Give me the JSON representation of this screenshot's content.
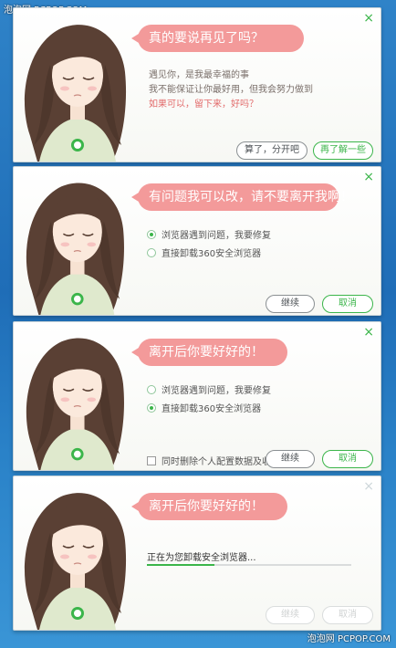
{
  "watermarks": {
    "top": "泡泡网 PCPOP.COM",
    "bottom": "泡泡网 PCPOP.COM"
  },
  "colors": {
    "accent_green": "#3bb54a",
    "bubble_pink": "#f39a9a",
    "desktop_blue": "#1f6db7"
  },
  "dialog1": {
    "bubble": "真的要说再见了吗？",
    "lines": [
      "遇见你，是我最幸福的事",
      "我不能保证让你最好用，但我会努力做到",
      "如果可以，留下来，好吗？"
    ],
    "btn_left": "算了，分开吧",
    "btn_right": "再了解一些",
    "close": "×"
  },
  "dialog2": {
    "bubble": "有问题我可以改，请不要离开我啊！",
    "option1": "浏览器遇到问题，我要修复",
    "option2": "直接卸载360安全浏览器",
    "selected": 1,
    "btn_left": "继续",
    "btn_right": "取消",
    "close": "×"
  },
  "dialog3": {
    "bubble": "离开后你要好好的！",
    "option1": "浏览器遇到问题，我要修复",
    "option2": "直接卸载360安全浏览器",
    "selected": 2,
    "checkbox": "同时删除个人配置数据及收藏",
    "btn_left": "继续",
    "btn_right": "取消",
    "close": "×"
  },
  "dialog4": {
    "bubble": "离开后你要好好的！",
    "status": "正在为您卸载安全浏览器...",
    "progress": 0.33,
    "btn_left": "继续",
    "btn_right": "取消",
    "close": "×"
  }
}
